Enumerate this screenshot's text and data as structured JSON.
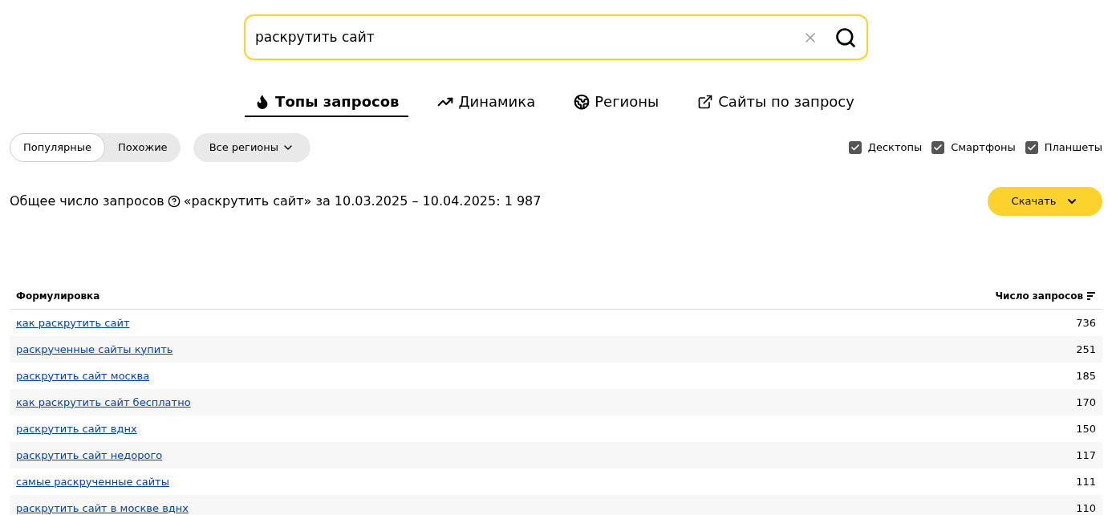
{
  "search": {
    "value": "раскрутить сайт"
  },
  "tabs": [
    {
      "label": "Топы запросов",
      "kind": "fire",
      "selected": true
    },
    {
      "label": "Динамика",
      "kind": "trend",
      "selected": false
    },
    {
      "label": "Регионы",
      "kind": "globe",
      "selected": false
    },
    {
      "label": "Сайты по запросу",
      "kind": "external",
      "selected": false
    }
  ],
  "mode_switch": [
    {
      "label": "Популярные",
      "selected": true
    },
    {
      "label": "Похожие",
      "selected": false
    }
  ],
  "region_dropdown": {
    "label": "Все регионы"
  },
  "devices": [
    {
      "label": "Десктопы",
      "checked": true
    },
    {
      "label": "Смартфоны",
      "checked": true
    },
    {
      "label": "Планшеты",
      "checked": true
    }
  ],
  "summary": {
    "label": "Общее число запросов",
    "text": "«раскрутить сайт» за 10.03.2025 – 10.04.2025: 1 987"
  },
  "download_button": {
    "label": "Скачать"
  },
  "table": {
    "columns": [
      "Формулировка",
      "Число запросов"
    ],
    "rows": [
      {
        "phrase": "как раскрутить сайт",
        "count": "736"
      },
      {
        "phrase": "раскрученные сайты купить",
        "count": "251"
      },
      {
        "phrase": "раскрутить сайт москва",
        "count": "185"
      },
      {
        "phrase": "как раскрутить сайт бесплатно",
        "count": "170"
      },
      {
        "phrase": "раскрутить сайт вднх",
        "count": "150"
      },
      {
        "phrase": "раскрутить сайт недорого",
        "count": "117"
      },
      {
        "phrase": "самые раскрученные сайты",
        "count": "111"
      },
      {
        "phrase": "раскрутить сайт в москве вднх",
        "count": "110"
      }
    ]
  }
}
